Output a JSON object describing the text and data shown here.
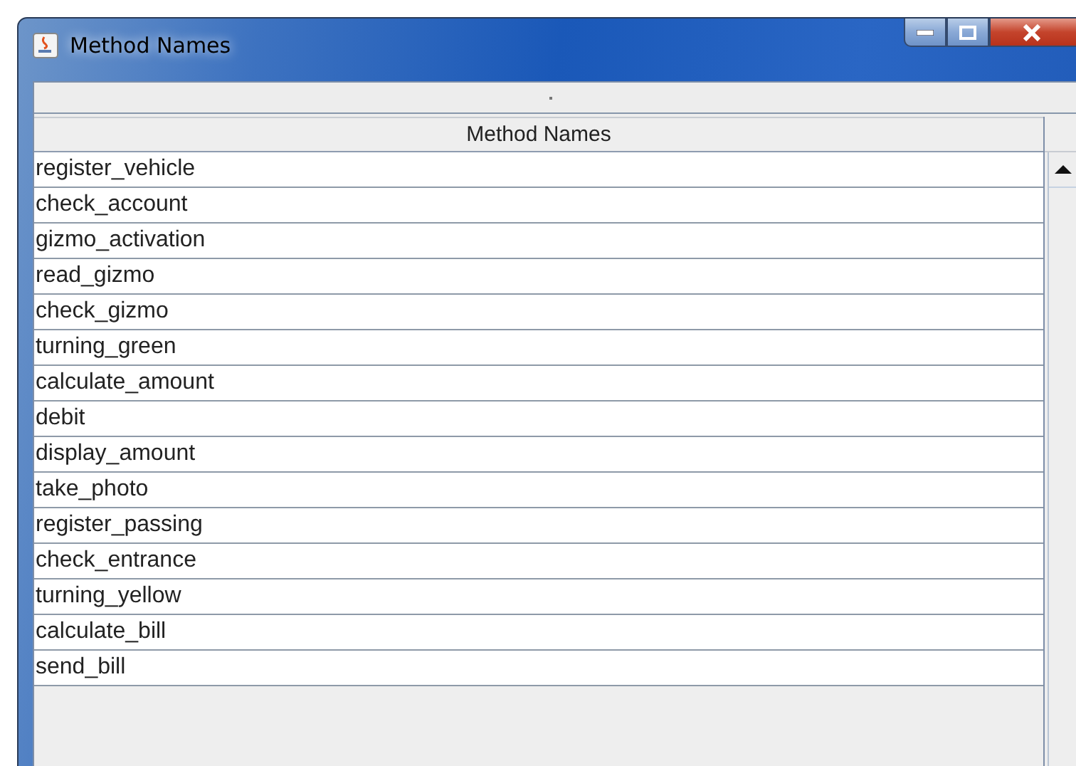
{
  "window": {
    "title": "Method Names"
  },
  "table": {
    "columns": [
      "Method Names"
    ],
    "rows": [
      "register_vehicle",
      "check_account",
      "gizmo_activation",
      "read_gizmo",
      "check_gizmo",
      "turning_green",
      "calculate_amount",
      "debit",
      "display_amount",
      "take_photo",
      "register_passing",
      "check_entrance",
      "turning_yellow",
      "calculate_bill",
      "send_bill"
    ]
  }
}
